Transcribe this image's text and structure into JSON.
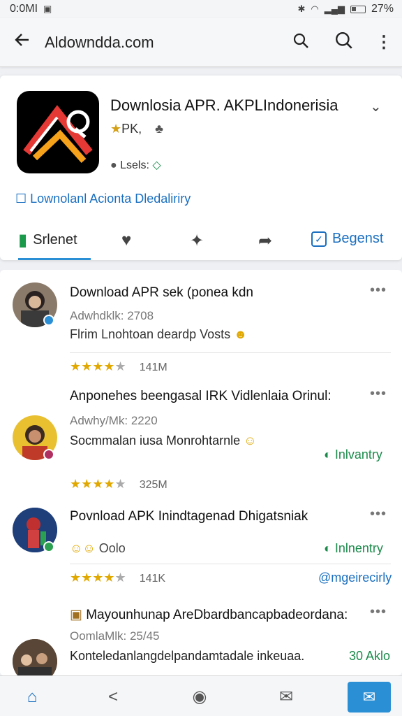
{
  "status_bar": {
    "time": "0:0MI",
    "battery": "27%"
  },
  "app_bar": {
    "title": "Aldowndda.com"
  },
  "app": {
    "name": "Downlosia APR. AKPLIndonerisia",
    "sub": "PK,",
    "status": "Lsels:",
    "link": "Lownolanl Acionta Dledaliriry",
    "tab_primary": "Srlenet",
    "tab_register": "Begenst"
  },
  "posts": [
    {
      "title": "Download APR sek (ponea kdn",
      "meta": "Adwhdklk: 2708",
      "text": "Flrim Lnohtoan deardp Vosts",
      "rating": "141M"
    },
    {
      "title": "Anponehes beengasal IRK Vidlenlaia Orinul:",
      "meta": "Adwhy/Mk: 2220",
      "text": "Socmmalan iusa Monrohtarnle",
      "status": "Inlvantry",
      "rating": "325M"
    },
    {
      "title": "Povnload APK Inindtagenad Dhigatsniak",
      "text": "Oolo",
      "status": "Inlnentry",
      "rating": "141K",
      "link": "@mgeirecirly"
    },
    {
      "title": "Mayounhunap AreDbardbancapbadeordana:",
      "meta": "OomlaMlk: 25/45",
      "text": "Konteledanlangdelpandamtadale inkeuaa.",
      "status": "30 Aklo"
    }
  ]
}
